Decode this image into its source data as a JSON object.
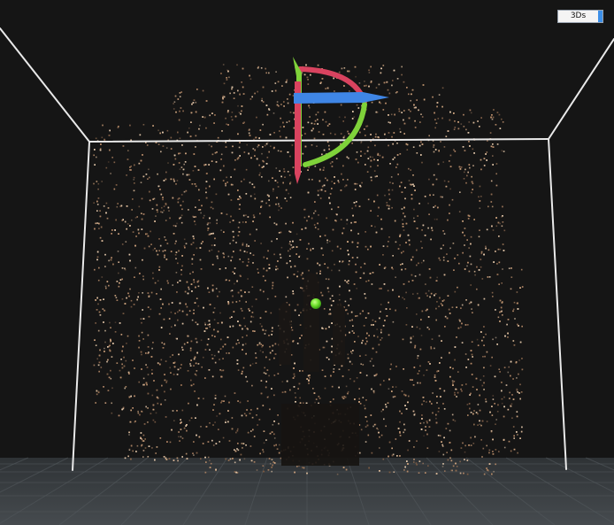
{
  "viewer": {
    "view_mode_label": "3Ds",
    "colors": {
      "background": "#151515",
      "bounding_box": "#e9e9e9",
      "floor": "#3b3f42",
      "floor_grid": "#52585c",
      "point_cloud": "#b58a68",
      "gizmo_x_axis": "#d9435f",
      "gizmo_y_axis": "#7fd23a",
      "gizmo_z_axis": "#3f86e6",
      "pivot_marker": "#6ee02c",
      "view_mode_indicator": "#3c8fe8"
    },
    "icons": {
      "transform_gizmo": "rotate-translate-gizmo",
      "pivot": "sphere-marker"
    }
  }
}
